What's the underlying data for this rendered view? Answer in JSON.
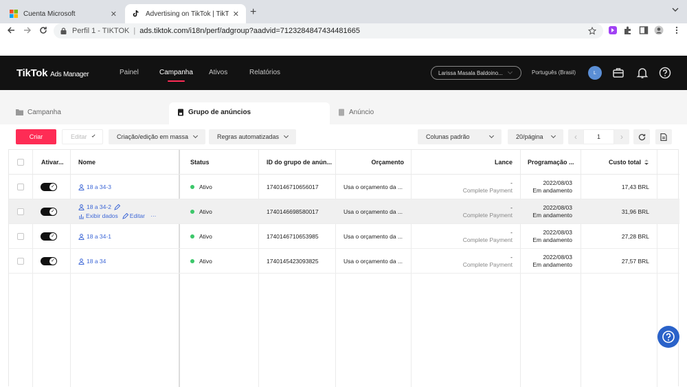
{
  "browser": {
    "tabs": [
      {
        "label": "Cuenta Microsoft",
        "close": "✕"
      },
      {
        "label": "Advertising on TikTok | TikTok A",
        "close": "✕"
      }
    ],
    "newtab": "+",
    "profile_label": "Perfil 1 - TIKTOK",
    "separator": "|",
    "url": "ads.tiktok.com/i18n/perf/adgroup?aadvid=7123284847434481665"
  },
  "header": {
    "logo": "TikTok",
    "logo_sub": "Ads Manager",
    "nav": [
      "Painel",
      "Campanha",
      "Ativos",
      "Relatórios"
    ],
    "account": "Larissa Masala Baldoino...",
    "language": "Português (Brasil)",
    "avatar": "L"
  },
  "level_tabs": [
    "Campanha",
    "Grupo de anúncios",
    "Anúncio"
  ],
  "toolbar": {
    "create": "Criar",
    "edit": "Editar",
    "bulk": "Criação/edição em massa",
    "rules": "Regras automatizadas",
    "columns": "Colunas padrão",
    "per_page": "20/página",
    "page": "1",
    "prev": "‹",
    "next": "›"
  },
  "table": {
    "headers": {
      "toggle": "Ativar...",
      "name": "Nome",
      "status": "Status",
      "id": "ID do grupo de anún...",
      "budget": "Orçamento",
      "bid": "Lance",
      "schedule": "Programação ...",
      "cost": "Custo total"
    },
    "row_actions": {
      "view": "Exibir dados",
      "edit": "Editar",
      "more": "···"
    },
    "rows": [
      {
        "name": "18 a 34-3",
        "status": "Ativo",
        "id": "1740146710656017",
        "budget": "Usa o orçamento da ...",
        "bid": "-",
        "bid_type": "Complete Payment",
        "date": "2022/08/03",
        "sched_status": "Em andamento",
        "cost": "17,43 BRL"
      },
      {
        "name": "18 a 34-2",
        "status": "Ativo",
        "id": "1740146698580017",
        "budget": "Usa o orçamento da ...",
        "bid": "-",
        "bid_type": "Complete Payment",
        "date": "2022/08/03",
        "sched_status": "Em andamento",
        "cost": "31,96 BRL"
      },
      {
        "name": "18 a 34-1",
        "status": "Ativo",
        "id": "1740146710653985",
        "budget": "Usa o orçamento da ...",
        "bid": "-",
        "bid_type": "Complete Payment",
        "date": "2022/08/03",
        "sched_status": "Em andamento",
        "cost": "27,28 BRL"
      },
      {
        "name": "18 a 34",
        "status": "Ativo",
        "id": "1740145423093825",
        "budget": "Usa o orçamento da ...",
        "bid": "-",
        "bid_type": "Complete Payment",
        "date": "2022/08/03",
        "sched_status": "Em andamento",
        "cost": "27,57 BRL"
      }
    ]
  },
  "colors": {
    "brand": "#fe2c55",
    "link": "#3d67d6",
    "active_dot": "#3cc76a",
    "header_bg": "#121212"
  }
}
